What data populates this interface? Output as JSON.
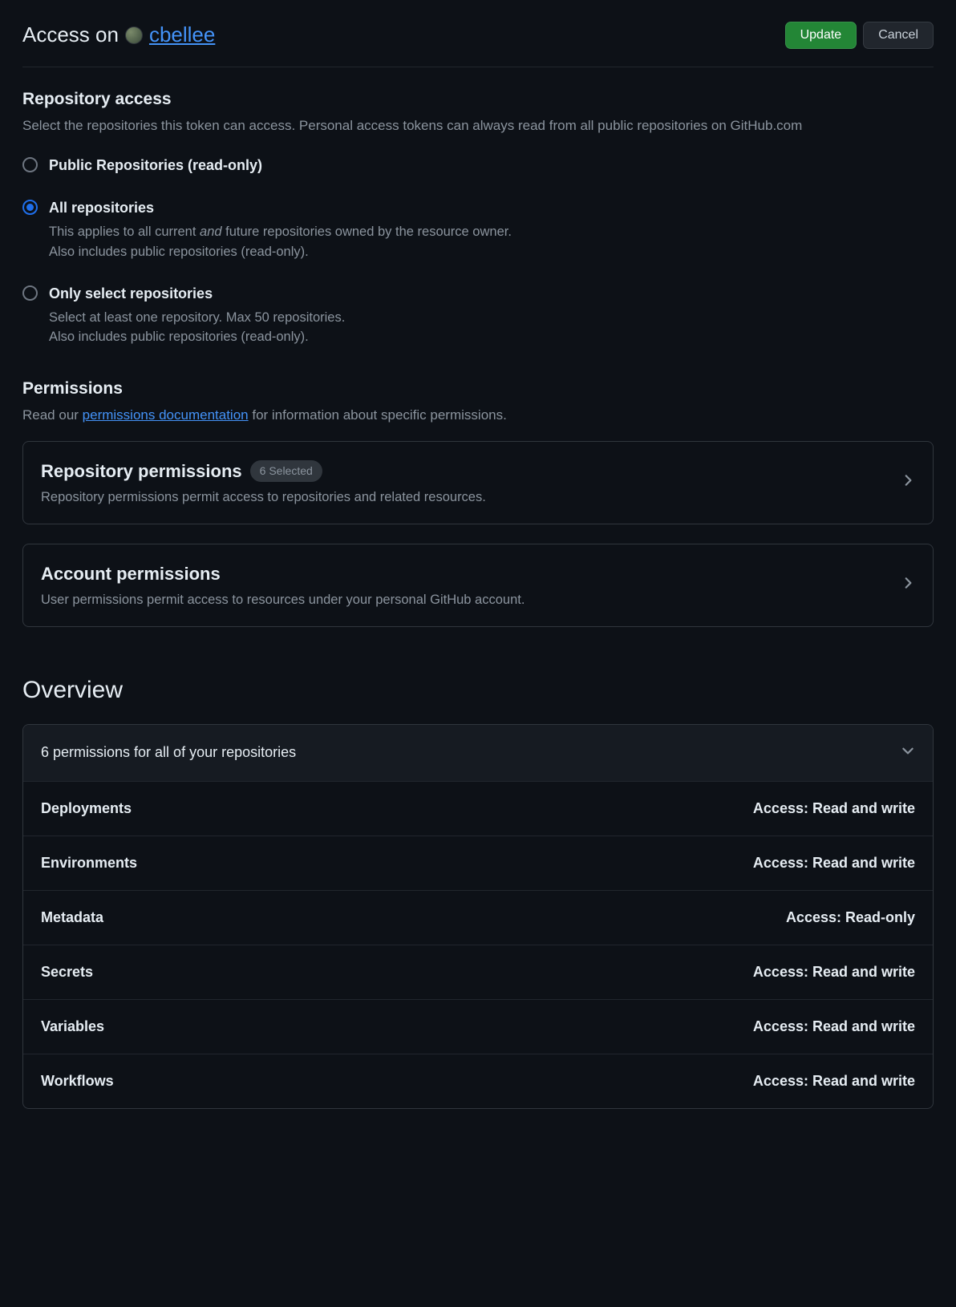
{
  "header": {
    "title_prefix": "Access on",
    "user": "cbellee",
    "update_btn": "Update",
    "cancel_btn": "Cancel"
  },
  "repo_access": {
    "title": "Repository access",
    "desc": "Select the repositories this token can access. Personal access tokens can always read from all public repositories on GitHub.com",
    "options": {
      "public": {
        "label": "Public Repositories (read-only)"
      },
      "all": {
        "label": "All repositories",
        "desc_a": "This applies to all current ",
        "desc_em": "and",
        "desc_b": " future repositories owned by the resource owner.",
        "desc_c": "Also includes public repositories (read-only)."
      },
      "select": {
        "label": "Only select repositories",
        "desc_a": "Select at least one repository. Max 50 repositories.",
        "desc_b": "Also includes public repositories (read-only)."
      }
    }
  },
  "permissions": {
    "title": "Permissions",
    "desc_a": "Read our ",
    "link": "permissions documentation",
    "desc_b": " for information about specific permissions.",
    "repo": {
      "title": "Repository permissions",
      "badge": "6 Selected",
      "desc": "Repository permissions permit access to repositories and related resources."
    },
    "account": {
      "title": "Account permissions",
      "desc": "User permissions permit access to resources under your personal GitHub account."
    }
  },
  "overview": {
    "title": "Overview",
    "header": "6 permissions for all of your repositories",
    "rows": [
      {
        "name": "Deployments",
        "access": "Access: Read and write"
      },
      {
        "name": "Environments",
        "access": "Access: Read and write"
      },
      {
        "name": "Metadata",
        "access": "Access: Read-only"
      },
      {
        "name": "Secrets",
        "access": "Access: Read and write"
      },
      {
        "name": "Variables",
        "access": "Access: Read and write"
      },
      {
        "name": "Workflows",
        "access": "Access: Read and write"
      }
    ]
  }
}
